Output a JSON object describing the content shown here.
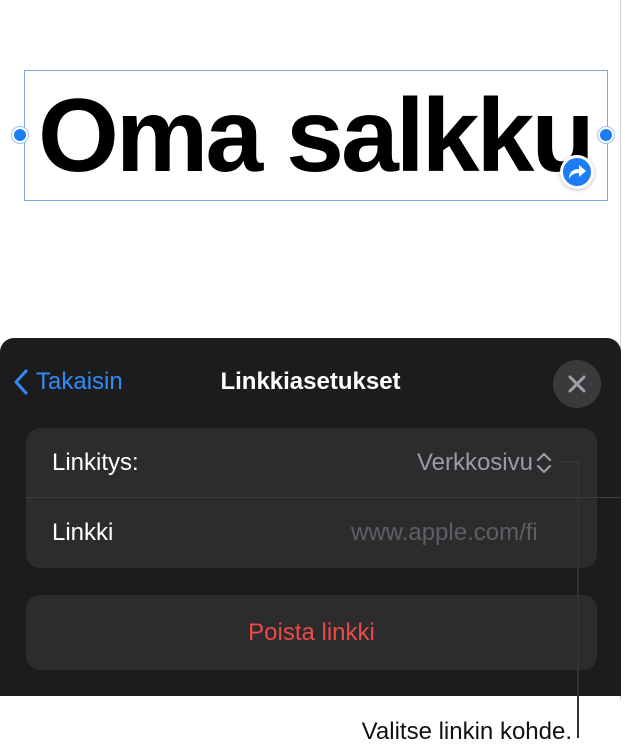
{
  "canvas": {
    "title": "Oma salkku"
  },
  "panel": {
    "back_label": "Takaisin",
    "title": "Linkkiasetukset",
    "rows": [
      {
        "label": "Linkitys:",
        "value": "Verkkosivu"
      },
      {
        "label": "Linkki",
        "value": "www.apple.com/fi"
      }
    ],
    "remove_label": "Poista linkki"
  },
  "callout": {
    "text": "Valitse linkin kohde."
  },
  "colors": {
    "accent": "#1c7cf4",
    "panel_bg": "#1c1c1e",
    "group_bg": "#2c2c2e",
    "destructive": "#ec4a45"
  },
  "icons": {
    "back": "chevron-left-icon",
    "close": "close-icon",
    "link_badge": "link-arrow-icon",
    "picker": "chevron-updown-icon"
  }
}
